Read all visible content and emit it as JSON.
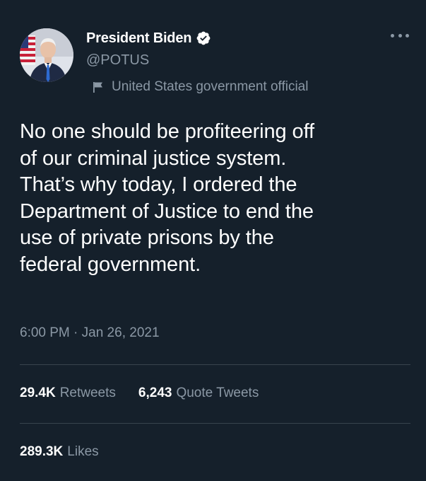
{
  "author": {
    "display_name": "President Biden",
    "handle": "@POTUS",
    "gov_label": "United States government official"
  },
  "icons": {
    "verified": "verified-badge-icon",
    "more": "more-options-icon",
    "flag": "flag-icon"
  },
  "tweet": {
    "text": "No one should be profiteering off\nof our criminal justice system.\nThat’s why today, I ordered the\nDepartment of Justice to end the\nuse of private prisons by the\nfederal government.",
    "timestamp": "6:00 PM · Jan 26, 2021"
  },
  "stats": {
    "retweets_count": "29.4K",
    "retweets_label": "Retweets",
    "quotes_count": "6,243",
    "quotes_label": "Quote Tweets",
    "likes_count": "289.3K",
    "likes_label": "Likes"
  },
  "colors": {
    "background": "#15202b",
    "text": "#ffffff",
    "secondary": "#8b98a5",
    "divider": "#38444d",
    "verified": "#ffffff"
  }
}
